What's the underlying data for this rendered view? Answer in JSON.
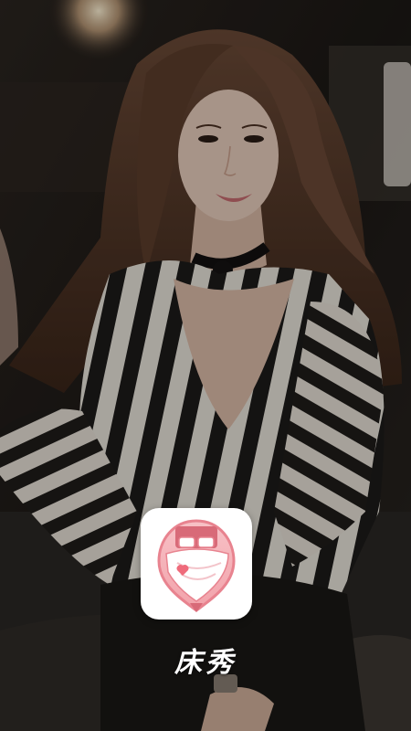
{
  "splash": {
    "background_photo": "woman-in-striped-top-photo",
    "app_icon": "bed-heart-app-icon",
    "app_name": "床秀"
  },
  "colors": {
    "icon_pink": "#f4a7b0",
    "icon_dark_pink": "#e57a86",
    "icon_bg": "#ffffff",
    "heart": "#ef6b7b"
  }
}
